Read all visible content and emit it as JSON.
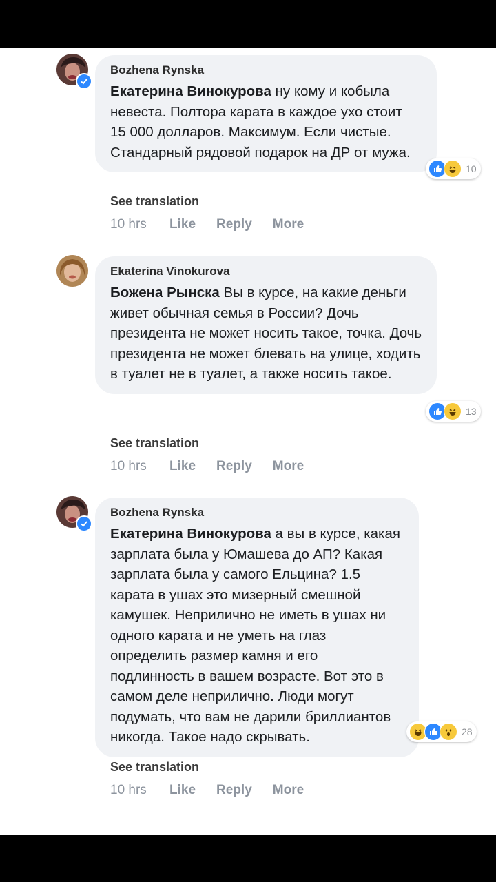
{
  "comments": [
    {
      "author": "Bozhena Rynska",
      "mention": "Екатерина Винокурова",
      "text": " ну кому и кобыла невеста. Полтора карата в каждое ухо стоит 15 000 долларов. Максимум. Если чистые. Стандарный рядовой подарок на ДР от мужа.",
      "reaction_count": "10",
      "reactions": [
        "like-icon",
        "haha-icon"
      ],
      "see_translation": "See translation",
      "time": "10 hrs",
      "like": "Like",
      "reply": "Reply",
      "more": "More"
    },
    {
      "author": "Ekaterina Vinokurova",
      "mention": "Божена Рынска",
      "text": " Вы в курсе, на какие деньги живет обычная семья в России? Дочь президента не может носить такое, точка. Дочь президента не может блевать на улице, ходить в туалет не в туалет, а также носить такое.",
      "reaction_count": "13",
      "reactions": [
        "like-icon",
        "haha-icon"
      ],
      "see_translation": "See translation",
      "time": "10 hrs",
      "like": "Like",
      "reply": "Reply",
      "more": "More"
    },
    {
      "author": "Bozhena Rynska",
      "mention": "Екатерина Винокурова",
      "text": " а вы в курсе, какая зарплата была у Юмашева до АП? Какая зарплата была у самого Ельцина? 1.5 карата в ушах это мизерный смешной камушек. Неприлично не иметь в ушах ни одного карата и не уметь на глаз определить размер камня и его подлинность в вашем возрасте. Вот это в самом деле неприлично. Люди могут подумать, что вам не дарили бриллиантов никогда. Такое надо скрывать.",
      "reaction_count": "28",
      "reactions": [
        "haha-icon",
        "like-icon",
        "wow-icon"
      ],
      "see_translation": "See translation",
      "time": "10 hrs",
      "like": "Like",
      "reply": "Reply",
      "more": "More"
    }
  ],
  "colors": {
    "bubble": "#f0f2f5",
    "like": "#2d88ff",
    "haha": "#f7c93b",
    "meta": "#8d949e"
  }
}
